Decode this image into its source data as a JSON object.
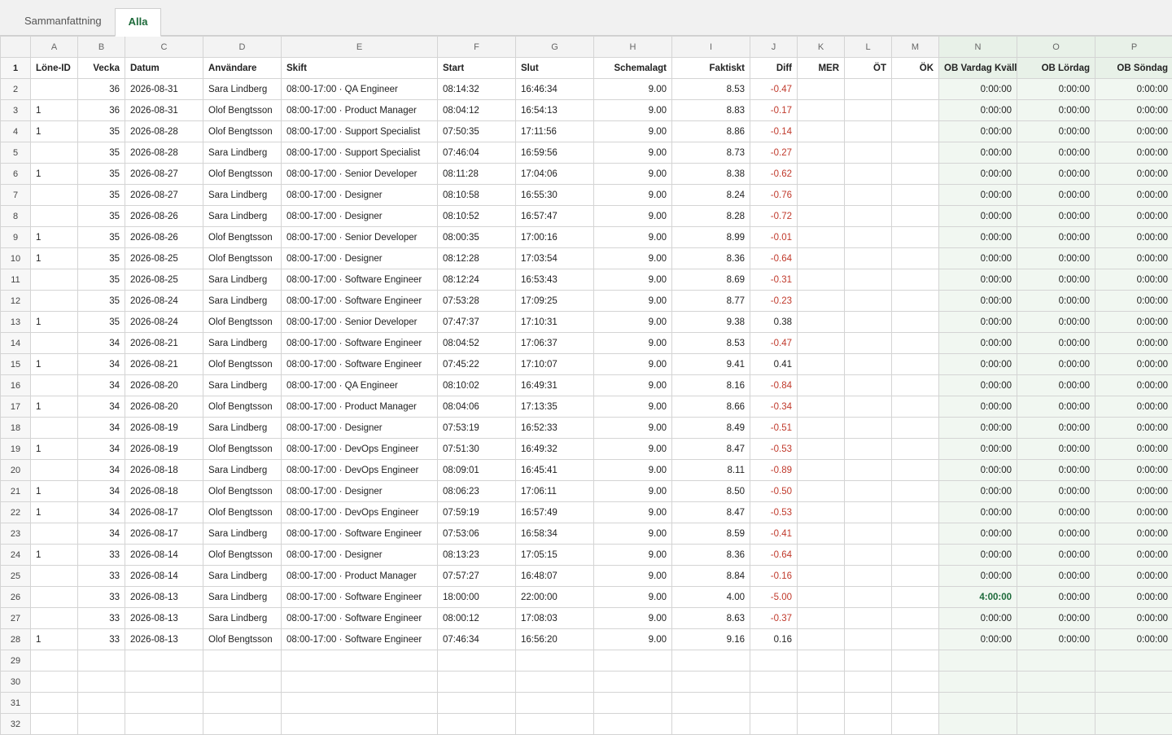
{
  "tabs": [
    "Sammanfattning",
    "Alla"
  ],
  "active_tab": 1,
  "column_letters": [
    "A",
    "B",
    "C",
    "D",
    "E",
    "F",
    "G",
    "H",
    "I",
    "J",
    "K",
    "L",
    "M",
    "N",
    "O",
    "P"
  ],
  "headers": [
    "Löne-ID",
    "Vecka",
    "Datum",
    "Användare",
    "Skift",
    "Start",
    "Slut",
    "Schemalagt",
    "Faktiskt",
    "Diff",
    "MER",
    "ÖT",
    "ÖK",
    "OB Vardag Kväll",
    "OB Lördag",
    "OB Söndag"
  ],
  "header_row_number": "1",
  "rows": [
    {
      "n": "2",
      "lone": "",
      "vecka": "36",
      "datum": "2026-08-31",
      "user": "Sara Lindberg",
      "skift": "08:00-17:00 · QA Engineer",
      "start": "08:14:32",
      "slut": "16:46:34",
      "sched": "9.00",
      "fakt": "8.53",
      "diff": "-0.47",
      "mer": "",
      "ot": "",
      "ok": "",
      "obv": "0:00:00",
      "obl": "0:00:00",
      "obs": "0:00:00"
    },
    {
      "n": "3",
      "lone": "1",
      "vecka": "36",
      "datum": "2026-08-31",
      "user": "Olof Bengtsson",
      "skift": "08:00-17:00 · Product Manager",
      "start": "08:04:12",
      "slut": "16:54:13",
      "sched": "9.00",
      "fakt": "8.83",
      "diff": "-0.17",
      "mer": "",
      "ot": "",
      "ok": "",
      "obv": "0:00:00",
      "obl": "0:00:00",
      "obs": "0:00:00"
    },
    {
      "n": "4",
      "lone": "1",
      "vecka": "35",
      "datum": "2026-08-28",
      "user": "Olof Bengtsson",
      "skift": "08:00-17:00 · Support Specialist",
      "start": "07:50:35",
      "slut": "17:11:56",
      "sched": "9.00",
      "fakt": "8.86",
      "diff": "-0.14",
      "mer": "",
      "ot": "",
      "ok": "",
      "obv": "0:00:00",
      "obl": "0:00:00",
      "obs": "0:00:00"
    },
    {
      "n": "5",
      "lone": "",
      "vecka": "35",
      "datum": "2026-08-28",
      "user": "Sara Lindberg",
      "skift": "08:00-17:00 · Support Specialist",
      "start": "07:46:04",
      "slut": "16:59:56",
      "sched": "9.00",
      "fakt": "8.73",
      "diff": "-0.27",
      "mer": "",
      "ot": "",
      "ok": "",
      "obv": "0:00:00",
      "obl": "0:00:00",
      "obs": "0:00:00"
    },
    {
      "n": "6",
      "lone": "1",
      "vecka": "35",
      "datum": "2026-08-27",
      "user": "Olof Bengtsson",
      "skift": "08:00-17:00 · Senior Developer",
      "start": "08:11:28",
      "slut": "17:04:06",
      "sched": "9.00",
      "fakt": "8.38",
      "diff": "-0.62",
      "mer": "",
      "ot": "",
      "ok": "",
      "obv": "0:00:00",
      "obl": "0:00:00",
      "obs": "0:00:00"
    },
    {
      "n": "7",
      "lone": "",
      "vecka": "35",
      "datum": "2026-08-27",
      "user": "Sara Lindberg",
      "skift": "08:00-17:00 · Designer",
      "start": "08:10:58",
      "slut": "16:55:30",
      "sched": "9.00",
      "fakt": "8.24",
      "diff": "-0.76",
      "mer": "",
      "ot": "",
      "ok": "",
      "obv": "0:00:00",
      "obl": "0:00:00",
      "obs": "0:00:00"
    },
    {
      "n": "8",
      "lone": "",
      "vecka": "35",
      "datum": "2026-08-26",
      "user": "Sara Lindberg",
      "skift": "08:00-17:00 · Designer",
      "start": "08:10:52",
      "slut": "16:57:47",
      "sched": "9.00",
      "fakt": "8.28",
      "diff": "-0.72",
      "mer": "",
      "ot": "",
      "ok": "",
      "obv": "0:00:00",
      "obl": "0:00:00",
      "obs": "0:00:00"
    },
    {
      "n": "9",
      "lone": "1",
      "vecka": "35",
      "datum": "2026-08-26",
      "user": "Olof Bengtsson",
      "skift": "08:00-17:00 · Senior Developer",
      "start": "08:00:35",
      "slut": "17:00:16",
      "sched": "9.00",
      "fakt": "8.99",
      "diff": "-0.01",
      "mer": "",
      "ot": "",
      "ok": "",
      "obv": "0:00:00",
      "obl": "0:00:00",
      "obs": "0:00:00"
    },
    {
      "n": "10",
      "lone": "1",
      "vecka": "35",
      "datum": "2026-08-25",
      "user": "Olof Bengtsson",
      "skift": "08:00-17:00 · Designer",
      "start": "08:12:28",
      "slut": "17:03:54",
      "sched": "9.00",
      "fakt": "8.36",
      "diff": "-0.64",
      "mer": "",
      "ot": "",
      "ok": "",
      "obv": "0:00:00",
      "obl": "0:00:00",
      "obs": "0:00:00"
    },
    {
      "n": "11",
      "lone": "",
      "vecka": "35",
      "datum": "2026-08-25",
      "user": "Sara Lindberg",
      "skift": "08:00-17:00 · Software Engineer",
      "start": "08:12:24",
      "slut": "16:53:43",
      "sched": "9.00",
      "fakt": "8.69",
      "diff": "-0.31",
      "mer": "",
      "ot": "",
      "ok": "",
      "obv": "0:00:00",
      "obl": "0:00:00",
      "obs": "0:00:00"
    },
    {
      "n": "12",
      "lone": "",
      "vecka": "35",
      "datum": "2026-08-24",
      "user": "Sara Lindberg",
      "skift": "08:00-17:00 · Software Engineer",
      "start": "07:53:28",
      "slut": "17:09:25",
      "sched": "9.00",
      "fakt": "8.77",
      "diff": "-0.23",
      "mer": "",
      "ot": "",
      "ok": "",
      "obv": "0:00:00",
      "obl": "0:00:00",
      "obs": "0:00:00"
    },
    {
      "n": "13",
      "lone": "1",
      "vecka": "35",
      "datum": "2026-08-24",
      "user": "Olof Bengtsson",
      "skift": "08:00-17:00 · Senior Developer",
      "start": "07:47:37",
      "slut": "17:10:31",
      "sched": "9.00",
      "fakt": "9.38",
      "diff": "0.38",
      "mer": "",
      "ot": "",
      "ok": "",
      "obv": "0:00:00",
      "obl": "0:00:00",
      "obs": "0:00:00"
    },
    {
      "n": "14",
      "lone": "",
      "vecka": "34",
      "datum": "2026-08-21",
      "user": "Sara Lindberg",
      "skift": "08:00-17:00 · Software Engineer",
      "start": "08:04:52",
      "slut": "17:06:37",
      "sched": "9.00",
      "fakt": "8.53",
      "diff": "-0.47",
      "mer": "",
      "ot": "",
      "ok": "",
      "obv": "0:00:00",
      "obl": "0:00:00",
      "obs": "0:00:00"
    },
    {
      "n": "15",
      "lone": "1",
      "vecka": "34",
      "datum": "2026-08-21",
      "user": "Olof Bengtsson",
      "skift": "08:00-17:00 · Software Engineer",
      "start": "07:45:22",
      "slut": "17:10:07",
      "sched": "9.00",
      "fakt": "9.41",
      "diff": "0.41",
      "mer": "",
      "ot": "",
      "ok": "",
      "obv": "0:00:00",
      "obl": "0:00:00",
      "obs": "0:00:00"
    },
    {
      "n": "16",
      "lone": "",
      "vecka": "34",
      "datum": "2026-08-20",
      "user": "Sara Lindberg",
      "skift": "08:00-17:00 · QA Engineer",
      "start": "08:10:02",
      "slut": "16:49:31",
      "sched": "9.00",
      "fakt": "8.16",
      "diff": "-0.84",
      "mer": "",
      "ot": "",
      "ok": "",
      "obv": "0:00:00",
      "obl": "0:00:00",
      "obs": "0:00:00"
    },
    {
      "n": "17",
      "lone": "1",
      "vecka": "34",
      "datum": "2026-08-20",
      "user": "Olof Bengtsson",
      "skift": "08:00-17:00 · Product Manager",
      "start": "08:04:06",
      "slut": "17:13:35",
      "sched": "9.00",
      "fakt": "8.66",
      "diff": "-0.34",
      "mer": "",
      "ot": "",
      "ok": "",
      "obv": "0:00:00",
      "obl": "0:00:00",
      "obs": "0:00:00"
    },
    {
      "n": "18",
      "lone": "",
      "vecka": "34",
      "datum": "2026-08-19",
      "user": "Sara Lindberg",
      "skift": "08:00-17:00 · Designer",
      "start": "07:53:19",
      "slut": "16:52:33",
      "sched": "9.00",
      "fakt": "8.49",
      "diff": "-0.51",
      "mer": "",
      "ot": "",
      "ok": "",
      "obv": "0:00:00",
      "obl": "0:00:00",
      "obs": "0:00:00"
    },
    {
      "n": "19",
      "lone": "1",
      "vecka": "34",
      "datum": "2026-08-19",
      "user": "Olof Bengtsson",
      "skift": "08:00-17:00 · DevOps Engineer",
      "start": "07:51:30",
      "slut": "16:49:32",
      "sched": "9.00",
      "fakt": "8.47",
      "diff": "-0.53",
      "mer": "",
      "ot": "",
      "ok": "",
      "obv": "0:00:00",
      "obl": "0:00:00",
      "obs": "0:00:00"
    },
    {
      "n": "20",
      "lone": "",
      "vecka": "34",
      "datum": "2026-08-18",
      "user": "Sara Lindberg",
      "skift": "08:00-17:00 · DevOps Engineer",
      "start": "08:09:01",
      "slut": "16:45:41",
      "sched": "9.00",
      "fakt": "8.11",
      "diff": "-0.89",
      "mer": "",
      "ot": "",
      "ok": "",
      "obv": "0:00:00",
      "obl": "0:00:00",
      "obs": "0:00:00"
    },
    {
      "n": "21",
      "lone": "1",
      "vecka": "34",
      "datum": "2026-08-18",
      "user": "Olof Bengtsson",
      "skift": "08:00-17:00 · Designer",
      "start": "08:06:23",
      "slut": "17:06:11",
      "sched": "9.00",
      "fakt": "8.50",
      "diff": "-0.50",
      "mer": "",
      "ot": "",
      "ok": "",
      "obv": "0:00:00",
      "obl": "0:00:00",
      "obs": "0:00:00"
    },
    {
      "n": "22",
      "lone": "1",
      "vecka": "34",
      "datum": "2026-08-17",
      "user": "Olof Bengtsson",
      "skift": "08:00-17:00 · DevOps Engineer",
      "start": "07:59:19",
      "slut": "16:57:49",
      "sched": "9.00",
      "fakt": "8.47",
      "diff": "-0.53",
      "mer": "",
      "ot": "",
      "ok": "",
      "obv": "0:00:00",
      "obl": "0:00:00",
      "obs": "0:00:00"
    },
    {
      "n": "23",
      "lone": "",
      "vecka": "34",
      "datum": "2026-08-17",
      "user": "Sara Lindberg",
      "skift": "08:00-17:00 · Software Engineer",
      "start": "07:53:06",
      "slut": "16:58:34",
      "sched": "9.00",
      "fakt": "8.59",
      "diff": "-0.41",
      "mer": "",
      "ot": "",
      "ok": "",
      "obv": "0:00:00",
      "obl": "0:00:00",
      "obs": "0:00:00"
    },
    {
      "n": "24",
      "lone": "1",
      "vecka": "33",
      "datum": "2026-08-14",
      "user": "Olof Bengtsson",
      "skift": "08:00-17:00 · Designer",
      "start": "08:13:23",
      "slut": "17:05:15",
      "sched": "9.00",
      "fakt": "8.36",
      "diff": "-0.64",
      "mer": "",
      "ot": "",
      "ok": "",
      "obv": "0:00:00",
      "obl": "0:00:00",
      "obs": "0:00:00"
    },
    {
      "n": "25",
      "lone": "",
      "vecka": "33",
      "datum": "2026-08-14",
      "user": "Sara Lindberg",
      "skift": "08:00-17:00 · Product Manager",
      "start": "07:57:27",
      "slut": "16:48:07",
      "sched": "9.00",
      "fakt": "8.84",
      "diff": "-0.16",
      "mer": "",
      "ot": "",
      "ok": "",
      "obv": "0:00:00",
      "obl": "0:00:00",
      "obs": "0:00:00"
    },
    {
      "n": "26",
      "lone": "",
      "vecka": "33",
      "datum": "2026-08-13",
      "user": "Sara Lindberg",
      "skift": "08:00-17:00 · Software Engineer",
      "start": "18:00:00",
      "slut": "22:00:00",
      "sched": "9.00",
      "fakt": "4.00",
      "diff": "-5.00",
      "mer": "",
      "ot": "",
      "ok": "",
      "obv": "4:00:00",
      "obl": "0:00:00",
      "obs": "0:00:00",
      "obv_highlight": true
    },
    {
      "n": "27",
      "lone": "",
      "vecka": "33",
      "datum": "2026-08-13",
      "user": "Sara Lindberg",
      "skift": "08:00-17:00 · Software Engineer",
      "start": "08:00:12",
      "slut": "17:08:03",
      "sched": "9.00",
      "fakt": "8.63",
      "diff": "-0.37",
      "mer": "",
      "ot": "",
      "ok": "",
      "obv": "0:00:00",
      "obl": "0:00:00",
      "obs": "0:00:00"
    },
    {
      "n": "28",
      "lone": "1",
      "vecka": "33",
      "datum": "2026-08-13",
      "user": "Olof Bengtsson",
      "skift": "08:00-17:00 · Software Engineer",
      "start": "07:46:34",
      "slut": "16:56:20",
      "sched": "9.00",
      "fakt": "9.16",
      "diff": "0.16",
      "mer": "",
      "ot": "",
      "ok": "",
      "obv": "0:00:00",
      "obl": "0:00:00",
      "obs": "0:00:00"
    }
  ],
  "empty_rows": [
    "29",
    "30",
    "31",
    "32"
  ],
  "colors": {
    "negative": "#c0392b",
    "accent": "#1d6a3a",
    "ob_header": "#e8f1e8",
    "ob_cell": "#f1f7f1"
  }
}
